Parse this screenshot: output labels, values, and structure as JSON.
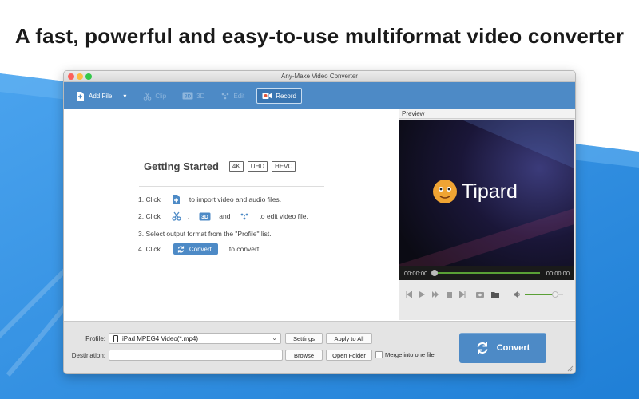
{
  "headline": "A fast, powerful and easy-to-use multiformat video converter",
  "window": {
    "title": "Any-Make Video Converter"
  },
  "toolbar": {
    "add_file": "Add File",
    "clip": "Clip",
    "three_d": "3D",
    "edit": "Edit",
    "record": "Record"
  },
  "getting_started": {
    "title": "Getting Started",
    "badges": [
      "4K",
      "UHD",
      "HEVC"
    ],
    "step1_prefix": "1. Click",
    "step1_suffix": "to import video and audio files.",
    "step2_prefix": "2. Click",
    "step2_comma": ",",
    "step2_3d": "3D",
    "step2_and": "and",
    "step2_suffix": "to edit video file.",
    "step3": "3. Select output format from the \"Profile\" list.",
    "step4_prefix": "4. Click",
    "step4_button": "Convert",
    "step4_suffix": "to convert."
  },
  "preview": {
    "label": "Preview",
    "brand": "Tipard",
    "time_current": "00:00:00",
    "time_total": "00:00:00",
    "progress": 0,
    "volume": 0.8
  },
  "bottom": {
    "profile_label": "Profile:",
    "profile_value": "iPad MPEG4 Video(*.mp4)",
    "settings": "Settings",
    "apply_all": "Apply to All",
    "destination_label": "Destination:",
    "destination_value": "",
    "browse": "Browse",
    "open_folder": "Open Folder",
    "merge": "Merge into one file",
    "convert": "Convert"
  },
  "colors": {
    "accent": "#4d8ac6",
    "background_blue": "#2f8ee0",
    "progress_green": "#5aa036"
  }
}
